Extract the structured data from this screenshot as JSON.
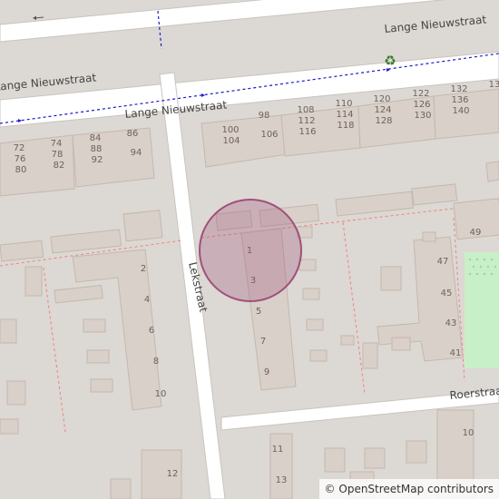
{
  "streets": {
    "top": "Lange Nieuwstraat",
    "upper_left": "Lange Nieuwstraat",
    "upper_right": "Lange Nieuwstraat",
    "vertical": "Lekstraat",
    "right": "Roerstraat"
  },
  "house_numbers": {
    "block_top_left": [
      "72",
      "76",
      "80",
      "74",
      "78",
      "82",
      "84",
      "88",
      "92",
      "86",
      "94"
    ],
    "block_top_right": [
      "100",
      "104",
      "98",
      "106",
      "108",
      "112",
      "116",
      "110",
      "114",
      "118",
      "120",
      "124",
      "128",
      "122",
      "126",
      "130",
      "132",
      "136",
      "140",
      "13"
    ],
    "center_block": [
      "1",
      "3",
      "5",
      "7",
      "9"
    ],
    "left_block": [
      "2",
      "4",
      "6",
      "8",
      "10"
    ],
    "right_block": [
      "47",
      "45",
      "43",
      "41",
      "49"
    ],
    "bottom": [
      "11",
      "13",
      "10",
      "12"
    ]
  },
  "icons": {
    "recycling": "recycling-icon",
    "one_way": "arrow-left-icon"
  },
  "marker": {
    "shape": "circle",
    "color": "#a0507a"
  },
  "attribution": {
    "copyright": "©",
    "text": "OpenStreetMap contributors"
  }
}
